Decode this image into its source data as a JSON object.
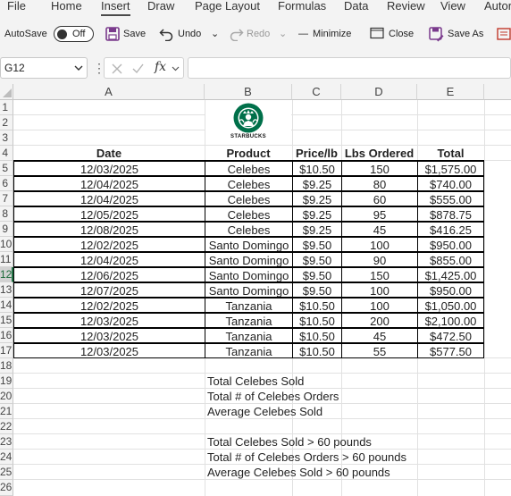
{
  "menu": {
    "items": [
      "File",
      "Home",
      "Insert",
      "Draw",
      "Page Layout",
      "Formulas",
      "Data",
      "Review",
      "View",
      "Autor"
    ],
    "active": "Insert"
  },
  "toolbar": {
    "autosave_label": "AutoSave",
    "autosave_state": "Off",
    "save_label": "Save",
    "undo_label": "Undo",
    "redo_label": "Redo",
    "minimize_label": "Minimize",
    "close_label": "Close",
    "saveas_label": "Save As"
  },
  "formula_bar": {
    "name_box": "G12",
    "fx_label": "fx",
    "formula": ""
  },
  "columns": [
    "A",
    "B",
    "C",
    "D",
    "E"
  ],
  "rows": [
    "1",
    "2",
    "3",
    "4",
    "5",
    "6",
    "7",
    "8",
    "9",
    "10",
    "11",
    "12",
    "13",
    "14",
    "15",
    "16",
    "17",
    "18",
    "19",
    "20",
    "21",
    "22",
    "23",
    "24",
    "25",
    "26"
  ],
  "selected_row": "12",
  "logo": {
    "text": "STARBUCKS"
  },
  "table": {
    "headers": [
      "Date",
      "Product",
      "Price/lb",
      "Lbs Ordered",
      "Total"
    ],
    "rows": [
      [
        "12/03/2025",
        "Celebes",
        "$10.50",
        "150",
        "$1,575.00"
      ],
      [
        "12/04/2025",
        "Celebes",
        "$9.25",
        "80",
        "$740.00"
      ],
      [
        "12/04/2025",
        "Celebes",
        "$9.25",
        "60",
        "$555.00"
      ],
      [
        "12/05/2025",
        "Celebes",
        "$9.25",
        "95",
        "$878.75"
      ],
      [
        "12/08/2025",
        "Celebes",
        "$9.25",
        "45",
        "$416.25"
      ],
      [
        "12/02/2025",
        "Santo Domingo",
        "$9.50",
        "100",
        "$950.00"
      ],
      [
        "12/04/2025",
        "Santo Domingo",
        "$9.50",
        "90",
        "$855.00"
      ],
      [
        "12/06/2025",
        "Santo Domingo",
        "$9.50",
        "150",
        "$1,425.00"
      ],
      [
        "12/07/2025",
        "Santo Domingo",
        "$9.50",
        "100",
        "$950.00"
      ],
      [
        "12/02/2025",
        "Tanzania",
        "$10.50",
        "100",
        "$1,050.00"
      ],
      [
        "12/03/2025",
        "Tanzania",
        "$10.50",
        "200",
        "$2,100.00"
      ],
      [
        "12/03/2025",
        "Tanzania",
        "$10.50",
        "45",
        "$472.50"
      ],
      [
        "12/03/2025",
        "Tanzania",
        "$10.50",
        "55",
        "$577.50"
      ]
    ]
  },
  "summary": {
    "total_celebes_sold": "Total Celebes Sold",
    "total_celebes_orders": "Total # of Celebes Orders",
    "average_celebes_sold": "Average Celebes Sold",
    "total_celebes_sold_60": "Total Celebes Sold > 60 pounds",
    "total_celebes_orders_60": "Total # of Celebes Orders > 60 pounds",
    "average_celebes_sold_60": "Average Celebes Sold > 60 pounds"
  }
}
